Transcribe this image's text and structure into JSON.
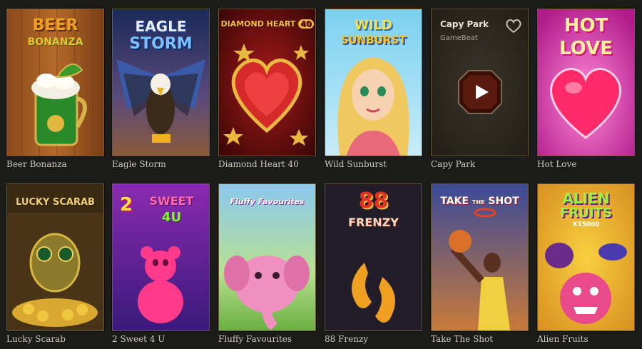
{
  "games": [
    {
      "label": "Beer Bonanza",
      "title_art": [
        "BEER",
        "BONANZA"
      ]
    },
    {
      "label": "Eagle Storm",
      "title_art": [
        "EAGLE",
        "STORM"
      ]
    },
    {
      "label": "Diamond Heart 40",
      "title_art": [
        "DIAMOND HEART",
        "40"
      ]
    },
    {
      "label": "Wild Sunburst",
      "title_art": [
        "WILD",
        "SUNBURST"
      ]
    },
    {
      "label": "Capy Park",
      "card_title": "Capy Park",
      "provider": "GameBeat"
    },
    {
      "label": "Hot Love",
      "title_art": [
        "HOT",
        "LOVE"
      ]
    },
    {
      "label": "Lucky Scarab",
      "title_art": [
        "LUCKY SCARAB"
      ]
    },
    {
      "label": "2 Sweet 4 U",
      "title_art": [
        "2",
        "SWEET",
        "4U"
      ]
    },
    {
      "label": "Fluffy Favourites",
      "title_art": [
        "Fluffy Favourites"
      ]
    },
    {
      "label": "88 Frenzy",
      "title_art": [
        "88",
        "FRENZY"
      ]
    },
    {
      "label": "Take The Shot",
      "title_art": [
        "TAKE",
        "THE",
        "SHOT"
      ]
    },
    {
      "label": "Alien Fruits",
      "title_art": [
        "ALIEN",
        "FRUITS",
        "X15000"
      ]
    }
  ],
  "icons": {
    "favorite": "heart-outline-icon",
    "play": "play-icon"
  },
  "colors": {
    "background": "#1b1b19",
    "frame": "#6b5a3a",
    "label_text": "#cfcac0"
  }
}
